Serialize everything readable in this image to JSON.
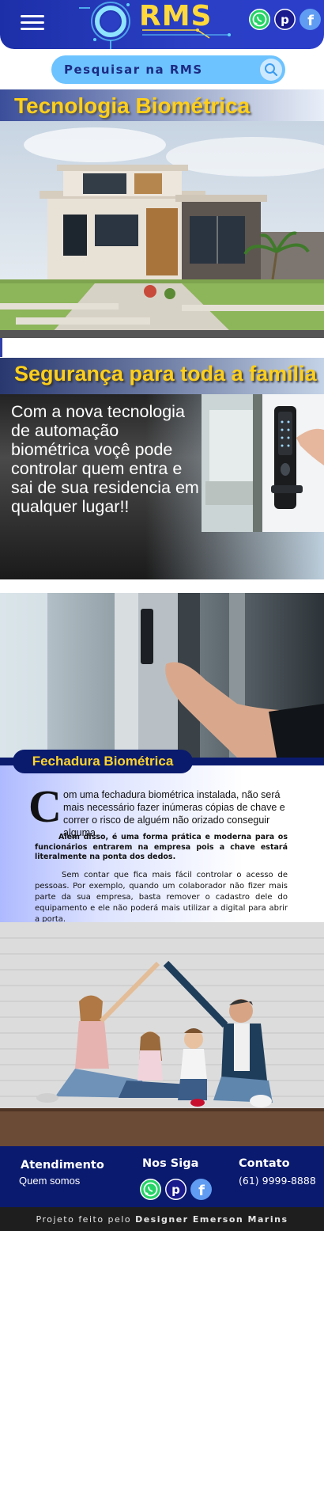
{
  "header": {
    "logo_text": "RMS",
    "menu_icon": "hamburger-menu-icon",
    "social": [
      {
        "name": "whatsapp",
        "icon": "whatsapp-icon",
        "color": "#25d366"
      },
      {
        "name": "pinterest",
        "icon": "pinterest-icon",
        "color": "#1a1a8c"
      },
      {
        "name": "facebook",
        "icon": "facebook-icon",
        "color": "#5f9cf2"
      }
    ]
  },
  "search": {
    "placeholder": "Pesquisar na RMS",
    "icon": "search-icon"
  },
  "section1": {
    "title": "Tecnologia Biométrica",
    "image": "modern-house-photo"
  },
  "section2": {
    "title": "Segurança para toda a família",
    "text": "Com a nova tecnologia de automação biométrica voçê pode controlar quem entra e sai de sua residencia em qualquer lugar!!",
    "image": "biometric-door-lock-photo"
  },
  "section3": {
    "image": "finger-touching-lock-photo",
    "heading": "Fechadura Biométrica",
    "dropcap": "C",
    "paragraph1": "om uma fechadura biométrica instalada, não será mais necessário fazer inúmeras cópias de chave e correr o risco de alguém não orizado conseguir alguma.",
    "paragraph2": "Além disso, é uma forma prática e moderna para os funcionários entrarem na empresa pois a chave estará literalmente na ponta dos dedos.",
    "paragraph3": "Sem contar que fica mais fácil controlar o acesso de pessoas. Por exemplo, quando um colaborador não fizer mais parte da sua empresa, basta remover o cadastro dele do equipamento e ele não poderá mais utilizar a digital para abrir a porta."
  },
  "family_image": "family-home-photo",
  "footer": {
    "atendimento_title": "Atendimento",
    "atendimento_link": "Quem somos",
    "siga_title": "Nos Siga",
    "contato_title": "Contato",
    "contato_phone": "(61) 9999-8888",
    "copyright_prefix": "Projeto feito pelo",
    "copyright_author": "Designer Emerson Marins"
  },
  "colors": {
    "header_blue": "#2a3fc4",
    "accent_yellow": "#ffcf1a",
    "footer_navy": "#0a1a6e",
    "search_blue": "#6dc3ff"
  }
}
